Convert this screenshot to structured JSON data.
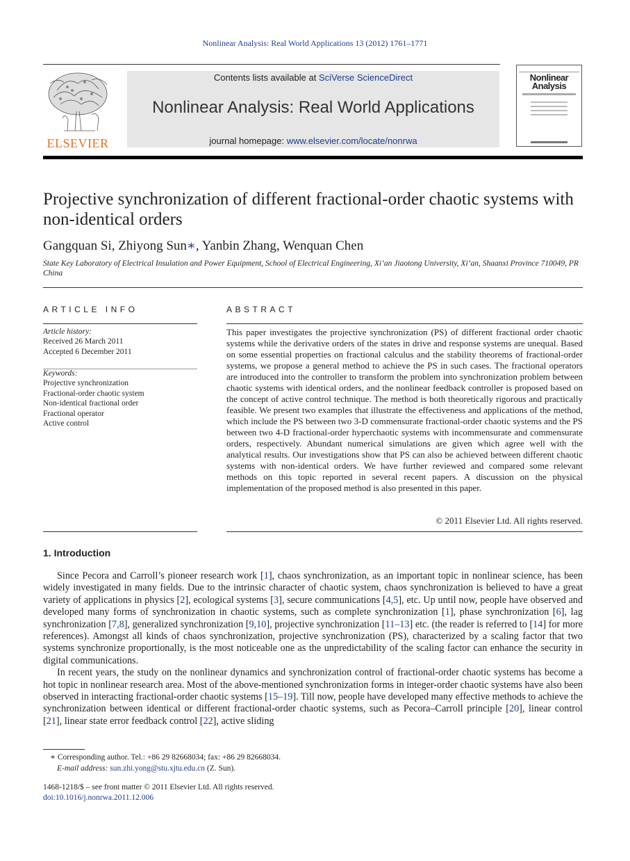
{
  "running_head": "Nonlinear Analysis: Real World Applications 13 (2012) 1761–1771",
  "publisher": {
    "logo_icon": "elsevier-tree-icon",
    "name": "ELSEVIER"
  },
  "banner": {
    "contents_prefix": "Contents lists available at ",
    "contents_link": "SciVerse ScienceDirect",
    "journal_title": "Nonlinear Analysis: Real World Applications",
    "homepage_prefix": "journal homepage: ",
    "homepage_link": "www.elsevier.com/locate/nonrwa"
  },
  "cover": {
    "title_line1": "Nonlinear",
    "title_line2": "Analysis"
  },
  "article": {
    "title": "Projective synchronization of different fractional-order chaotic systems with non-identical orders",
    "authors": [
      "Gangquan Si",
      "Zhiyong Sun",
      "Yanbin Zhang",
      "Wenquan Chen"
    ],
    "corresponding_mark": "∗",
    "affiliation": "State Key Laboratory of Electrical Insulation and Power Equipment, School of Electrical Engineering, Xi’an Jiaotong University, Xi’an, Shaanxi Province 710049, PR China"
  },
  "article_info": {
    "heading": "ARTICLE INFO",
    "history_label": "Article history:",
    "received": "Received 26 March 2011",
    "accepted": "Accepted 6 December 2011",
    "keywords_label": "Keywords:",
    "keywords": [
      "Projective synchronization",
      "Fractional-order chaotic system",
      "Non-identical fractional order",
      "Fractional operator",
      "Active control"
    ]
  },
  "abstract": {
    "heading": "ABSTRACT",
    "text": "This paper investigates the projective synchronization (PS) of different fractional order chaotic systems while the derivative orders of the states in drive and response systems are unequal. Based on some essential properties on fractional calculus and the stability theorems of fractional-order systems, we propose a general method to achieve the PS in such cases. The fractional operators are introduced into the controller to transform the problem into synchronization problem between chaotic systems with identical orders, and the nonlinear feedback controller is proposed based on the concept of active control technique. The method is both theoretically rigorous and practically feasible. We present two examples that illustrate the effectiveness and applications of the method, which include the PS between two 3-D commensurate fractional-order chaotic systems and the PS between two 4-D fractional-order hyperchaotic systems with incommensurate and commensurate orders, respectively. Abundant numerical simulations are given which agree well with the analytical results. Our investigations show that PS can also be achieved between different chaotic systems with non-identical orders. We have further reviewed and compared some relevant methods on this topic reported in several recent papers. A discussion on the physical implementation of the proposed method is also presented in this paper.",
    "copyright": "© 2011 Elsevier Ltd. All rights reserved."
  },
  "introduction": {
    "heading": "1.  Introduction",
    "paragraphs": [
      [
        {
          "t": "Since Pecora and Carroll’s pioneer research work ["
        },
        {
          "r": "1"
        },
        {
          "t": "], chaos synchronization, as an important topic in nonlinear science, has been widely investigated in many fields. Due to the intrinsic character of chaotic system, chaos synchronization is believed to have a great variety of applications in physics ["
        },
        {
          "r": "2"
        },
        {
          "t": "], ecological systems ["
        },
        {
          "r": "3"
        },
        {
          "t": "], secure communications ["
        },
        {
          "r": "4,5"
        },
        {
          "t": "], etc. Up until now, people have observed and developed many forms of synchronization in chaotic systems, such as complete synchronization ["
        },
        {
          "r": "1"
        },
        {
          "t": "], phase synchronization ["
        },
        {
          "r": "6"
        },
        {
          "t": "], lag synchronization ["
        },
        {
          "r": "7,8"
        },
        {
          "t": "], generalized synchronization ["
        },
        {
          "r": "9,10"
        },
        {
          "t": "], projective synchronization ["
        },
        {
          "r": "11–13"
        },
        {
          "t": "] etc. (the reader is referred to ["
        },
        {
          "r": "14"
        },
        {
          "t": "] for more references). Amongst all kinds of chaos synchronization, projective synchronization (PS), characterized by a scaling factor that two systems synchronize proportionally, is the most noticeable one as the unpredictability of the scaling factor can enhance the security in digital communications."
        }
      ],
      [
        {
          "t": "In recent years, the study on the nonlinear dynamics and synchronization control of fractional-order chaotic systems has become a hot topic in nonlinear research area. Most of the above-mentioned synchronization forms in integer-order chaotic systems have also been observed in interacting fractional-order chaotic systems ["
        },
        {
          "r": "15–19"
        },
        {
          "t": "]. Till now, people have developed many effective methods to achieve the synchronization between identical or different fractional-order chaotic systems, such as Pecora–Carroll principle ["
        },
        {
          "r": "20"
        },
        {
          "t": "], linear control ["
        },
        {
          "r": "21"
        },
        {
          "t": "], linear state error feedback control ["
        },
        {
          "r": "22"
        },
        {
          "t": "], active sliding"
        }
      ]
    ]
  },
  "footnote": {
    "mark": "∗",
    "corresponding": "Corresponding author. Tel.: +86 29 82668034; fax: +86 29 82668034.",
    "email_label": "E-mail address:",
    "email": "sun.zhi.yong@stu.xjtu.edu.cn",
    "email_suffix": " (Z. Sun)."
  },
  "issn_line": "1468-1218/$ – see front matter © 2011 Elsevier Ltd. All rights reserved.",
  "doi": "doi:10.1016/j.nonrwa.2011.12.006",
  "colors": {
    "link": "#1a3d8f",
    "elsevier_orange": "#e9711c",
    "banner_bg": "#e6e6e6"
  }
}
